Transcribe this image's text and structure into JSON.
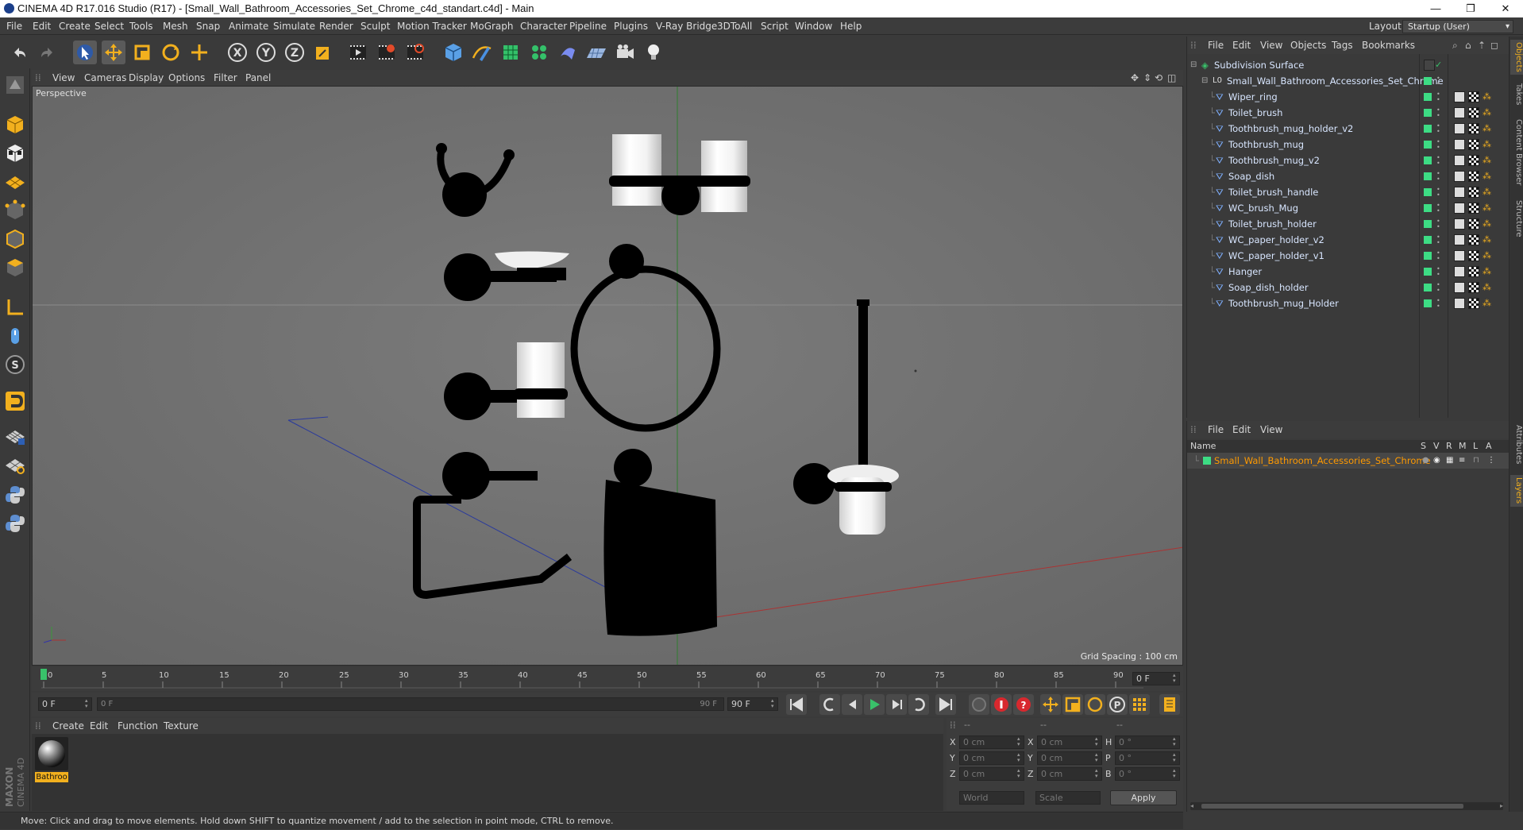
{
  "window": {
    "title": "CINEMA 4D R17.016 Studio (R17) - [Small_Wall_Bathroom_Accessories_Set_Chrome_c4d_standart.c4d] - Main",
    "controls": [
      "—",
      "❐",
      "✕"
    ]
  },
  "menubar": {
    "items": [
      "File",
      "Edit",
      "Create",
      "Select",
      "Tools",
      "Mesh",
      "Snap",
      "Animate",
      "Simulate",
      "Render",
      "Sculpt",
      "Motion Tracker",
      "MoGraph",
      "Character",
      "Pipeline",
      "Plugins",
      "V-Ray Bridge",
      "3DToAll",
      "Script",
      "Window",
      "Help"
    ],
    "layout_label": "Layout:",
    "layout_value": "Startup (User)"
  },
  "toolbar": {
    "icons": [
      "undo-icon",
      "redo-icon",
      "live-selection-icon",
      "move-icon",
      "scale-icon",
      "rotate-icon",
      "last-tool-icon",
      "x-axis-icon",
      "y-axis-icon",
      "z-axis-icon",
      "coordinate-system-icon",
      "render-view-icon",
      "render-picture-viewer-icon",
      "render-settings-icon",
      "cube-primitive-icon",
      "spline-pen-icon",
      "subdivision-surface-icon",
      "cloner-icon",
      "deformer-icon",
      "floor-icon",
      "camera-icon",
      "light-icon"
    ]
  },
  "left_tools": {
    "icons": [
      "workplane-icon",
      "model-mode-icon",
      "texture-mode-icon",
      "axis-mode-icon",
      "points-mode-icon",
      "edges-mode-icon",
      "polygons-mode-icon",
      "enable-axis-icon",
      "tweak-icon",
      "snap-icon",
      "magnet-icon",
      "lock-workplane-icon",
      "solo-icon",
      "python-icon",
      "python-generator-icon"
    ]
  },
  "viewport": {
    "menu": [
      "View",
      "Cameras",
      "Display",
      "Options",
      "Filter",
      "Panel"
    ],
    "camera_label": "Perspective",
    "grid_spacing": "Grid Spacing : 100 cm",
    "background_color": "#747474"
  },
  "timeline": {
    "ticks": [
      "0",
      "5",
      "10",
      "15",
      "20",
      "25",
      "30",
      "35",
      "40",
      "45",
      "50",
      "55",
      "60",
      "65",
      "70",
      "75",
      "80",
      "85",
      "90"
    ],
    "current_frame_box": "0 F"
  },
  "transport": {
    "start_field": "0 F",
    "range_start": "0 F",
    "range_end": "90 F",
    "end_field": "90 F"
  },
  "materials": {
    "menu": [
      "Create",
      "Edit",
      "Function",
      "Texture"
    ],
    "items": [
      {
        "label": "Bathroo"
      }
    ]
  },
  "coordinates": {
    "header": [
      "--",
      "--",
      "--"
    ],
    "rows": [
      {
        "a": "X",
        "av": "0 cm",
        "b": "X",
        "bv": "0 cm",
        "c": "H",
        "cv": "0 °"
      },
      {
        "a": "Y",
        "av": "0 cm",
        "b": "Y",
        "bv": "0 cm",
        "c": "P",
        "cv": "0 °"
      },
      {
        "a": "Z",
        "av": "0 cm",
        "b": "Z",
        "bv": "0 cm",
        "c": "B",
        "cv": "0 °"
      }
    ],
    "mode1": "World",
    "mode2": "Scale",
    "apply": "Apply"
  },
  "status": {
    "text": "Move: Click and drag to move elements. Hold down SHIFT to quantize movement / add to the selection in point mode, CTRL to remove."
  },
  "branding": "MAXON CINEMA 4D",
  "objects": {
    "menu": [
      "File",
      "Edit",
      "View",
      "Objects",
      "Tags",
      "Bookmarks"
    ],
    "root": "Subdivision Surface",
    "group": "Small_Wall_Bathroom_Accessories_Set_Chrome",
    "children": [
      "Wiper_ring",
      "Toilet_brush",
      "Toothbrush_mug_holder_v2",
      "Toothbrush_mug",
      "Toothbrush_mug_v2",
      "Soap_dish",
      "Toilet_brush_handle",
      "WC_brush_Mug",
      "Toilet_brush_holder",
      "WC_paper_holder_v2",
      "WC_paper_holder_v1",
      "Hanger",
      "Soap_dish_holder",
      "Toothbrush_mug_Holder"
    ],
    "color_swatch": "#3ddc84"
  },
  "right_tabs": [
    "Objects",
    "Takes",
    "Content Browser",
    "Structure",
    "Attributes",
    "Layers"
  ],
  "layers": {
    "menu": [
      "File",
      "Edit",
      "View"
    ],
    "header": [
      "Name",
      "S",
      "V",
      "R",
      "M",
      "L",
      "A"
    ],
    "row": "Small_Wall_Bathroom_Accessories_Set_Chrome",
    "row_color": "#ff9a00"
  }
}
